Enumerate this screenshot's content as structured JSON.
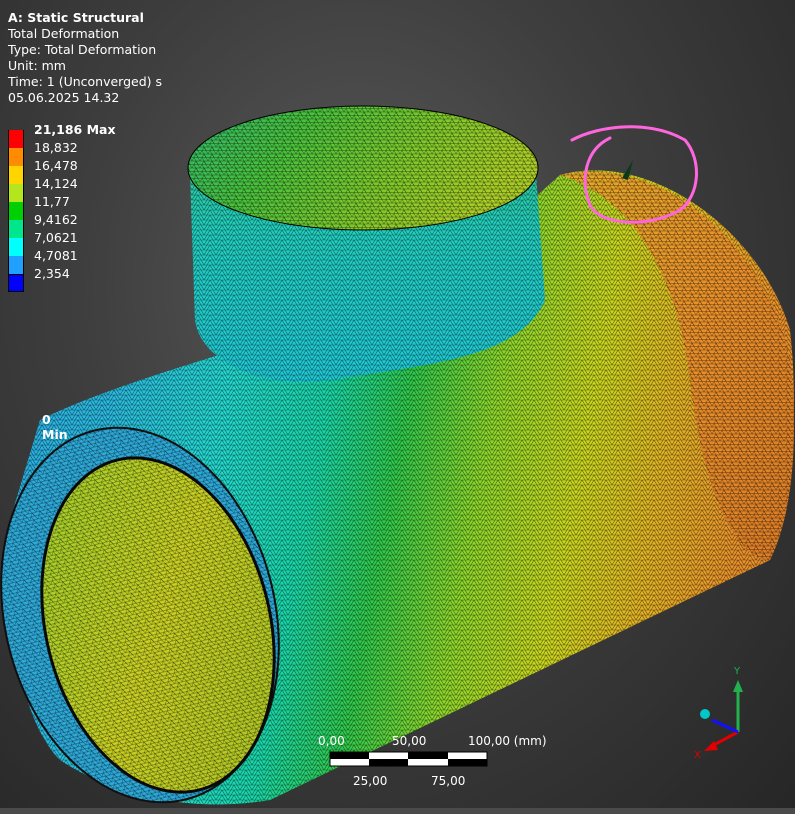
{
  "info": {
    "title": "A: Static Structural",
    "result": "Total Deformation",
    "type": "Type: Total Deformation",
    "unit": "Unit: mm",
    "time": "Time: 1 (Unconverged) s",
    "date": "05.06.2025 14.32"
  },
  "legend": {
    "levels": [
      {
        "label": "21,186 Max",
        "color": "#ff0000",
        "bold": true
      },
      {
        "label": "18,832",
        "color": "#ff8c00",
        "bold": false
      },
      {
        "label": "16,478",
        "color": "#ffd400",
        "bold": false
      },
      {
        "label": "14,124",
        "color": "#b5e61d",
        "bold": false
      },
      {
        "label": "11,77",
        "color": "#00d000",
        "bold": false
      },
      {
        "label": "9,4162",
        "color": "#00e68c",
        "bold": false
      },
      {
        "label": "7,0621",
        "color": "#00ffff",
        "bold": false
      },
      {
        "label": "4,7081",
        "color": "#1fa0ff",
        "bold": false
      },
      {
        "label": "2,354",
        "color": "#0000ff",
        "bold": false
      }
    ],
    "min_label": "0 Min"
  },
  "scale_bar": {
    "top_labels": [
      "0,00",
      "50,00",
      "100,00 (mm)"
    ],
    "bottom_labels": [
      "25,00",
      "75,00"
    ]
  },
  "triad": {
    "y_label": "Y",
    "x_label": "X",
    "y_color": "#22b14c",
    "x_color": "#e00000",
    "z_color": "#1010ff",
    "origin_color": "#00c8c8"
  },
  "annotation": {
    "color": "#ff66dd"
  }
}
